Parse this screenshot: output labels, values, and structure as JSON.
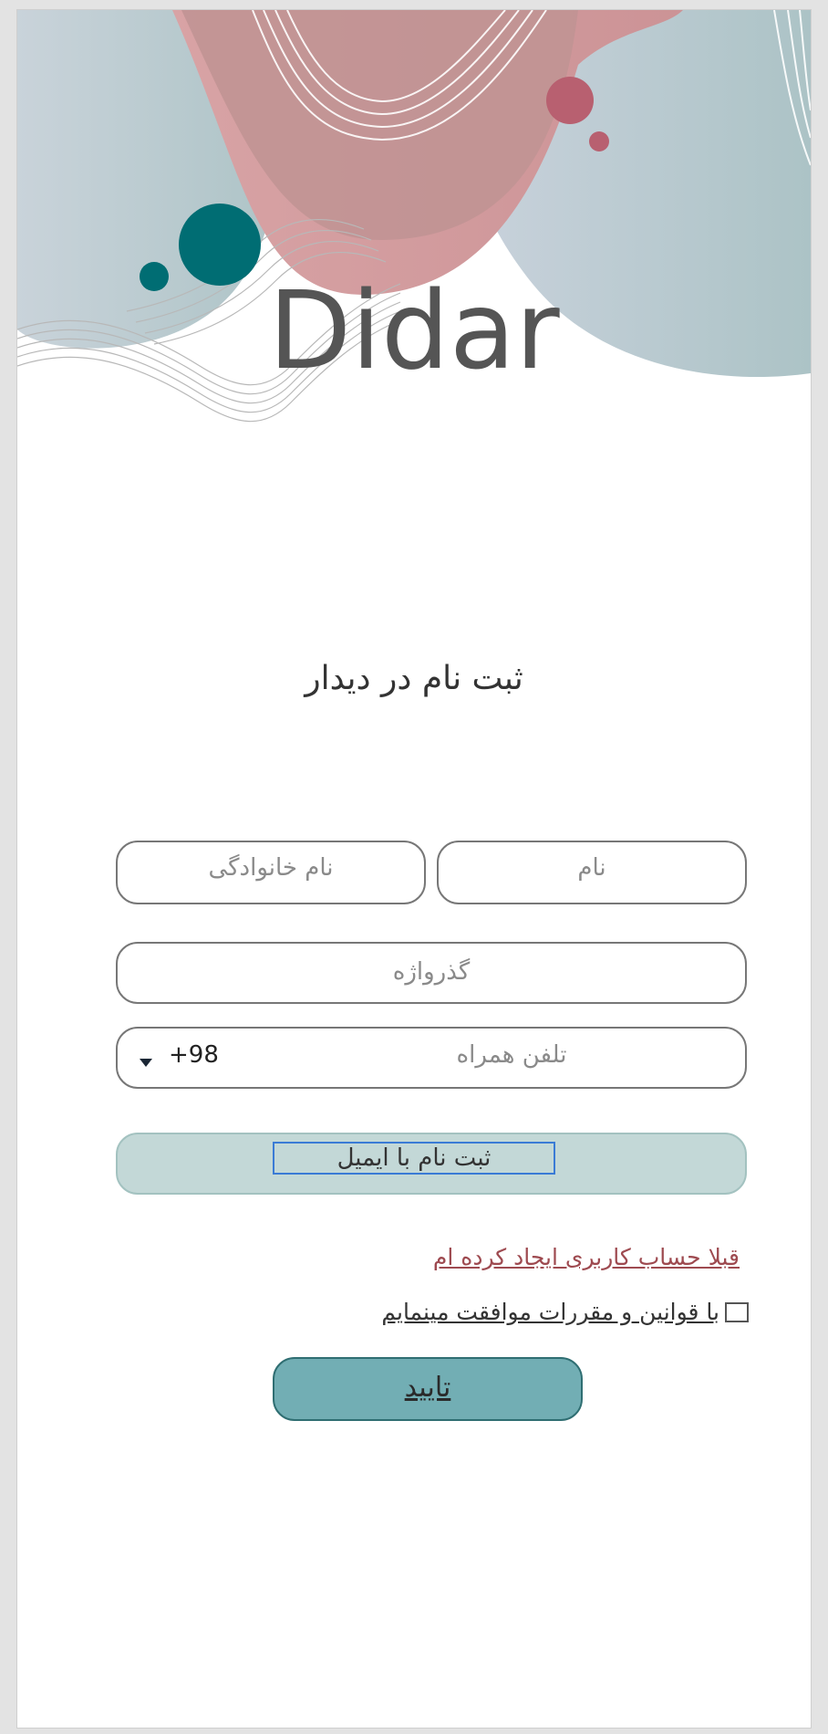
{
  "app": {
    "brand": "Didar",
    "title": "ثبت نام در دیدار"
  },
  "form": {
    "first_name_placeholder": "نام",
    "last_name_placeholder": "نام خانوادگی",
    "password_placeholder": "گذرواژه",
    "phone_placeholder": "تلفن همراه",
    "country_code": "+98",
    "email_signup_label": "ثبت نام با ایمیل",
    "login_link": "قبلا حساب کاربری ایجاد کرده ام",
    "terms_label": "با قوانین و مقررات موافقت مینمایم",
    "terms_checked": false,
    "submit_label": "تایید"
  },
  "colors": {
    "accent_teal": "#72aeb4",
    "dark_teal": "#006d73",
    "rose": "#b86070",
    "link": "#9e4a50",
    "email_button_bg": "#c3d8d7"
  },
  "icons": {
    "dropdown": "caret-down-icon"
  }
}
